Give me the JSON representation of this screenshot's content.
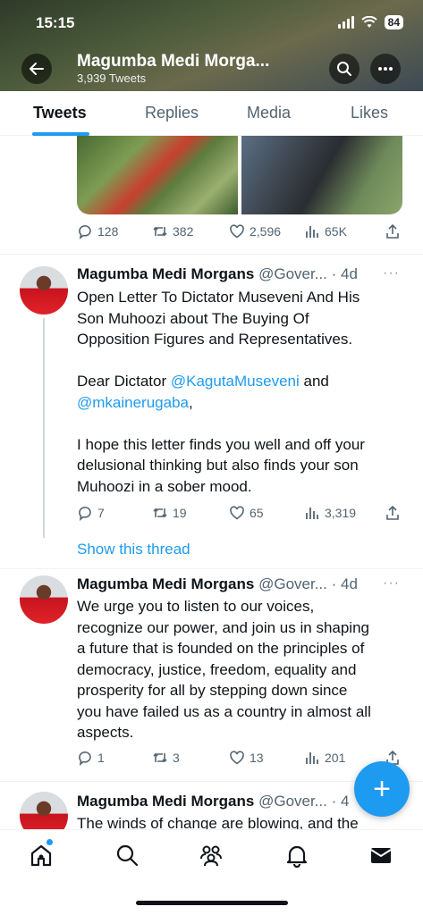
{
  "status": {
    "time": "15:15",
    "battery": "84"
  },
  "profile": {
    "name": "Magumba Medi Morga...",
    "tweet_count": "3,939 Tweets"
  },
  "tabs": [
    {
      "label": "Tweets",
      "active": true
    },
    {
      "label": "Replies",
      "active": false
    },
    {
      "label": "Media",
      "active": false
    },
    {
      "label": "Likes",
      "active": false
    }
  ],
  "top_tweet": {
    "replies": "128",
    "retweets": "382",
    "likes": "2,596",
    "views": "65K"
  },
  "tweets": [
    {
      "name": "Magumba Medi Morgans",
      "handle": "@Gover...",
      "time": "· 4d",
      "lines": [
        "Open Letter To Dictator Museveni And His",
        "Son Muhoozi about The Buying Of",
        "Opposition Figures and Representatives."
      ],
      "salutation_prefix": "Dear Dictator ",
      "mention1": "@KagutaMuseveni",
      "salutation_and": " and",
      "mention2": "@mkainerugaba",
      "salutation_end": ",",
      "lines2": [
        "I hope this letter finds you well and off your",
        "delusional thinking but also finds your son",
        "Muhoozi in a sober mood."
      ],
      "replies": "7",
      "retweets": "19",
      "likes": "65",
      "views": "3,319"
    },
    {
      "name": "Magumba Medi Morgans",
      "handle": "@Gover...",
      "time": "· 4d",
      "lines": [
        "We urge you to listen to our voices,",
        "recognize our power, and join us in shaping",
        "a future that is founded on the principles of",
        "democracy, justice, freedom, equality and",
        "prosperity for all by stepping down since",
        "you have failed us as a country in almost all",
        "aspects."
      ],
      "replies": "1",
      "retweets": "3",
      "likes": "13",
      "views": "201"
    },
    {
      "name": "Magumba Medi Morgans",
      "handle": "@Gover...",
      "time": "· 4",
      "lines": [
        "The winds of change are blowing, and the"
      ]
    }
  ],
  "show_thread": "Show this thread",
  "fab_label": "+",
  "colors": {
    "accent": "#1d9bf0",
    "text": "#0f1419",
    "muted": "#536471"
  }
}
